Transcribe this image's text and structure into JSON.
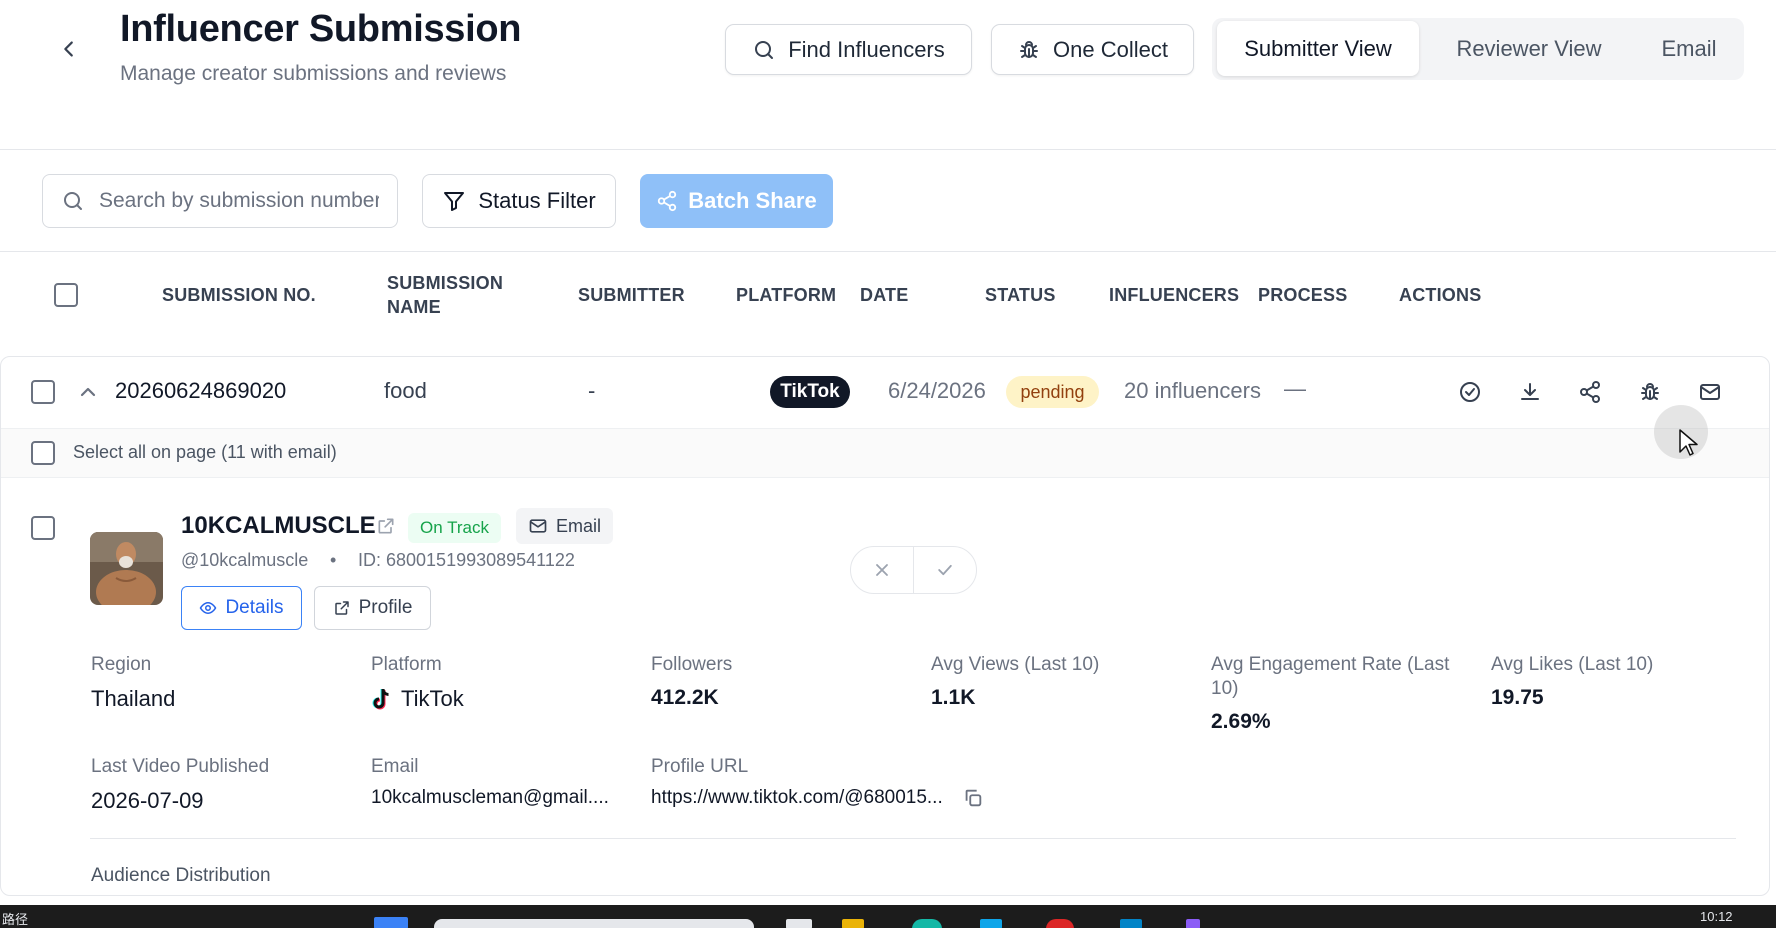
{
  "header": {
    "title": "Influencer Submission",
    "subtitle": "Manage creator submissions and reviews",
    "find_influencers": "Find Influencers",
    "one_collect": "One Collect",
    "tabs": [
      {
        "label": "Submitter View",
        "active": true
      },
      {
        "label": "Reviewer View",
        "active": false
      },
      {
        "label": "Email",
        "active": false
      }
    ]
  },
  "toolbar": {
    "search_placeholder": "Search by submission number",
    "status_filter": "Status Filter",
    "batch_share": "Batch Share"
  },
  "table": {
    "headers": {
      "submission_no": "SUBMISSION NO.",
      "submission_name_1": "SUBMISSION",
      "submission_name_2": "NAME",
      "submitter": "SUBMITTER",
      "platform": "PLATFORM",
      "date": "DATE",
      "status": "STATUS",
      "influencers": "INFLUENCERS",
      "process": "PROCESS",
      "actions": "ACTIONS"
    },
    "row": {
      "submission_no": "20260624869020",
      "name": "food",
      "submitter": "-",
      "platform": "TikTok",
      "date": "6/24/2026",
      "status": "pending",
      "influencers": "20 influencers",
      "process": "—"
    },
    "select_all": "Select all on page (11 with email)"
  },
  "influencer": {
    "name": "10KCALMUSCLE",
    "status": "On Track",
    "email_chip": "Email",
    "handle": "@10kcalmuscle",
    "separator": "•",
    "id": "ID: 6800151993089541122",
    "details_btn": "Details",
    "profile_btn": "Profile",
    "stats": {
      "region_label": "Region",
      "region": "Thailand",
      "platform_label": "Platform",
      "platform": "TikTok",
      "followers_label": "Followers",
      "followers": "412.2K",
      "views_label": "Avg Views (Last 10)",
      "views": "1.1K",
      "engagement_label_1": "Avg Engagement Rate (Last",
      "engagement_label_2": "10)",
      "engagement": "2.69%",
      "likes_label": "Avg Likes (Last 10)",
      "likes": "19.75",
      "last_video_label": "Last Video Published",
      "last_video": "2026-07-09",
      "email_label": "Email",
      "email": "10kcalmuscleman@gmail....",
      "url_label": "Profile URL",
      "url": "https://www.tiktok.com/@680015..."
    },
    "audience_label": "Audience Distribution"
  },
  "taskbar": {
    "left_text": "路径",
    "clock": "10:12"
  },
  "colors": {
    "primary": "#3b82f6",
    "batch_share_bg": "#8fc0f8",
    "pending_bg": "#fef3c7",
    "pending_text": "#92400e",
    "on_track_bg": "#ecfdf3",
    "on_track_text": "#16a34a"
  },
  "icons": [
    "chevron-left-icon",
    "search-icon",
    "bug-icon",
    "filter-icon",
    "share-icon",
    "chevron-up-icon",
    "check-circle-icon",
    "download-icon",
    "mail-icon",
    "external-link-icon",
    "eye-icon",
    "close-icon",
    "check-icon",
    "tiktok-icon",
    "copy-icon"
  ]
}
